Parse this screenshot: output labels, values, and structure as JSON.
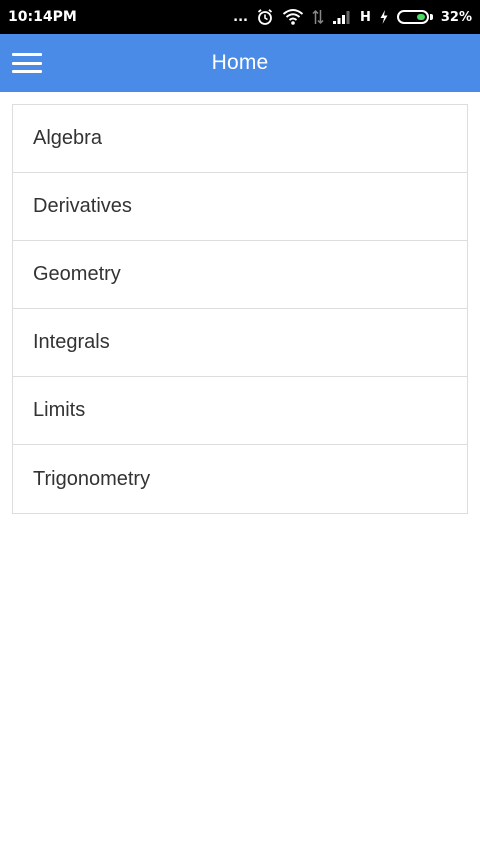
{
  "status_bar": {
    "time": "10:14PM",
    "dots": "...",
    "network_type": "H",
    "battery_percent": "32%",
    "battery_level": 0.32,
    "icons": [
      "alarm-icon",
      "wifi-icon",
      "data-arrows-icon",
      "signal-icon",
      "charging-icon",
      "battery-icon"
    ]
  },
  "header": {
    "title": "Home",
    "menu_icon": "hamburger-menu-icon",
    "background": "#4a8be8"
  },
  "topics": [
    {
      "label": "Algebra"
    },
    {
      "label": "Derivatives"
    },
    {
      "label": "Geometry"
    },
    {
      "label": "Integrals"
    },
    {
      "label": "Limits"
    },
    {
      "label": "Trigonometry"
    }
  ]
}
